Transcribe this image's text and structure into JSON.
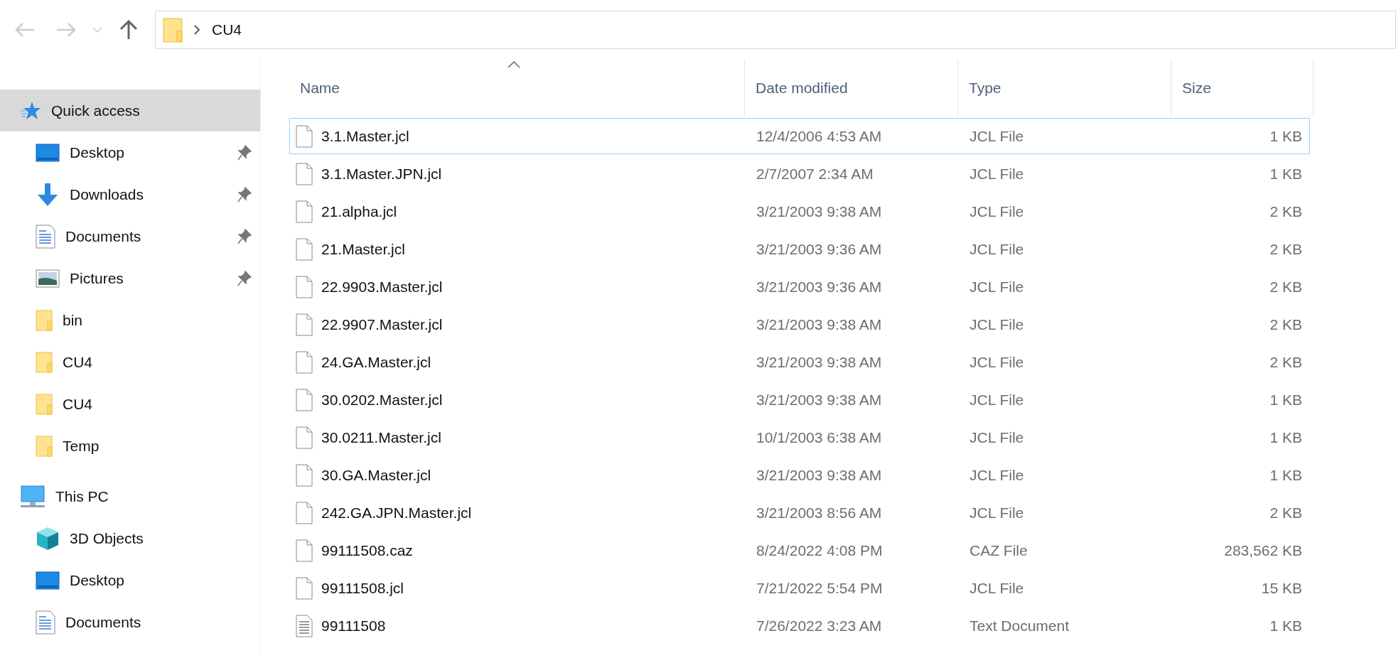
{
  "address_bar": {
    "path": [
      "CU4"
    ]
  },
  "sidebar": {
    "items": [
      {
        "label": "Quick access",
        "kind": "quick",
        "selected": true,
        "children": [
          {
            "label": "Desktop",
            "kind": "desktop",
            "pinned": true,
            "selected": false
          },
          {
            "label": "Downloads",
            "kind": "downloads",
            "pinned": true,
            "selected": false
          },
          {
            "label": "Documents",
            "kind": "documents",
            "pinned": true,
            "selected": false
          },
          {
            "label": "Pictures",
            "kind": "pictures",
            "pinned": true,
            "selected": false
          },
          {
            "label": "bin",
            "kind": "folder",
            "pinned": false,
            "selected": false
          },
          {
            "label": "CU4",
            "kind": "folder",
            "pinned": false,
            "selected": false
          },
          {
            "label": "CU4",
            "kind": "folder",
            "pinned": false,
            "selected": false
          },
          {
            "label": "Temp",
            "kind": "folder",
            "pinned": false,
            "selected": false
          }
        ]
      },
      {
        "label": "This PC",
        "kind": "pc",
        "selected": false,
        "children": [
          {
            "label": "3D Objects",
            "kind": "objects",
            "selected": false
          },
          {
            "label": "Desktop",
            "kind": "desktop",
            "selected": false
          },
          {
            "label": "Documents",
            "kind": "documents",
            "selected": false
          }
        ]
      }
    ]
  },
  "table": {
    "columns": [
      {
        "label": "Name",
        "sorted": true
      },
      {
        "label": "Date modified",
        "sorted": false
      },
      {
        "label": "Type",
        "sorted": false
      },
      {
        "label": "Size",
        "sorted": false
      }
    ],
    "rows": [
      {
        "name": "3.1.Master.jcl",
        "date": "12/4/2006 4:53 AM",
        "type": "JCL File",
        "size": "1 KB",
        "kind": "file",
        "focused": true
      },
      {
        "name": "3.1.Master.JPN.jcl",
        "date": "2/7/2007 2:34 AM",
        "type": "JCL File",
        "size": "1 KB",
        "kind": "file",
        "focused": false
      },
      {
        "name": "21.alpha.jcl",
        "date": "3/21/2003 9:38 AM",
        "type": "JCL File",
        "size": "2 KB",
        "kind": "file",
        "focused": false
      },
      {
        "name": "21.Master.jcl",
        "date": "3/21/2003 9:36 AM",
        "type": "JCL File",
        "size": "2 KB",
        "kind": "file",
        "focused": false
      },
      {
        "name": "22.9903.Master.jcl",
        "date": "3/21/2003 9:36 AM",
        "type": "JCL File",
        "size": "2 KB",
        "kind": "file",
        "focused": false
      },
      {
        "name": "22.9907.Master.jcl",
        "date": "3/21/2003 9:38 AM",
        "type": "JCL File",
        "size": "2 KB",
        "kind": "file",
        "focused": false
      },
      {
        "name": "24.GA.Master.jcl",
        "date": "3/21/2003 9:38 AM",
        "type": "JCL File",
        "size": "2 KB",
        "kind": "file",
        "focused": false
      },
      {
        "name": "30.0202.Master.jcl",
        "date": "3/21/2003 9:38 AM",
        "type": "JCL File",
        "size": "1 KB",
        "kind": "file",
        "focused": false
      },
      {
        "name": "30.0211.Master.jcl",
        "date": "10/1/2003 6:38 AM",
        "type": "JCL File",
        "size": "1 KB",
        "kind": "file",
        "focused": false
      },
      {
        "name": "30.GA.Master.jcl",
        "date": "3/21/2003 9:38 AM",
        "type": "JCL File",
        "size": "1 KB",
        "kind": "file",
        "focused": false
      },
      {
        "name": "242.GA.JPN.Master.jcl",
        "date": "3/21/2003 8:56 AM",
        "type": "JCL File",
        "size": "2 KB",
        "kind": "file",
        "focused": false
      },
      {
        "name": "99111508.caz",
        "date": "8/24/2022 4:08 PM",
        "type": "CAZ File",
        "size": "283,562 KB",
        "kind": "file",
        "focused": false
      },
      {
        "name": "99111508.jcl",
        "date": "7/21/2022 5:54 PM",
        "type": "JCL File",
        "size": "15 KB",
        "kind": "file",
        "focused": false
      },
      {
        "name": "99111508",
        "date": "7/26/2022 3:23 AM",
        "type": "Text Document",
        "size": "1 KB",
        "kind": "text",
        "focused": false
      }
    ]
  }
}
